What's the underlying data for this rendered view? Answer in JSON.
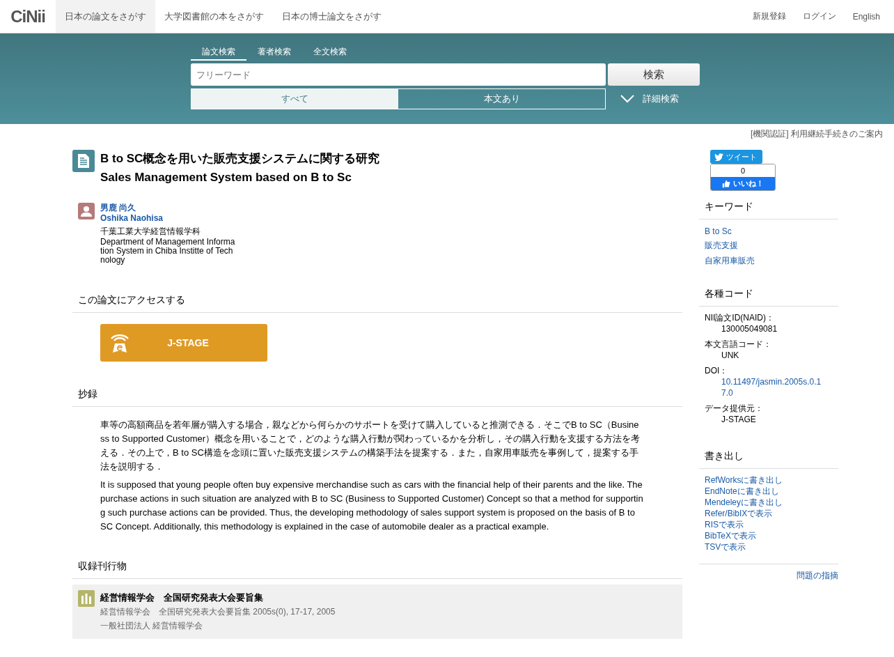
{
  "header": {
    "logo": "CiNii",
    "nav": [
      {
        "label": "日本の論文をさがす",
        "selected": true
      },
      {
        "label": "大学図書館の本をさがす",
        "selected": false
      },
      {
        "label": "日本の博士論文をさがす",
        "selected": false
      }
    ],
    "account_links": [
      "新規登録",
      "ログイン",
      "English"
    ]
  },
  "search": {
    "tabs": [
      {
        "label": "論文検索",
        "selected": true
      },
      {
        "label": "著者検索",
        "selected": false
      },
      {
        "label": "全文検索",
        "selected": false
      }
    ],
    "placeholder": "フリーワード",
    "button": "検索",
    "filters": [
      {
        "label": "すべて",
        "selected": true
      },
      {
        "label": "本文あり",
        "selected": false
      }
    ],
    "advanced": "詳細検索"
  },
  "notice": "[機関認証] 利用継続手続きのご案内",
  "article": {
    "title_ja": "B to SC概念を用いた販売支援システムに関する研究",
    "title_en": "Sales Management System based on B to Sc",
    "authors": [
      {
        "name_ja": "男鹿 尚久",
        "name_en": "Oshika Naohisa",
        "affiliation_ja": "千葉工業大学経営情報学科",
        "affiliation_en": "Department of Management Information System in Chiba Institte of Technology"
      }
    ],
    "access_heading": "この論文にアクセスする",
    "access_button": "J-STAGE",
    "abstract_heading": "抄録",
    "abstract": [
      "車等の高額商品を若年層が購入する場合，親などから何らかのサポートを受けて購入していると推測できる．そこでB to SC（Business to Supported Customer）概念を用いることで，どのような購入行動が関わっているかを分析し，その購入行動を支援する方法を考える．その上で，B to SC構造を念頭に置いた販売支援システムの構築手法を提案する．また，自家用車販売を事例して，提案する手法を説明する．",
      "It is supposed that young people often buy expensive merchandise such as cars with the financial help of their parents and the like. The purchase actions in such situation are analyzed with B to SC (Business to Supported Customer) Concept so that a method for supporting such purchase actions can be provided. Thus, the developing methodology of sales support system is proposed on the basis of B to SC Concept. Additionally, this methodology is explained in the case of automobile dealer as a practical example."
    ],
    "journal_heading": "収録刊行物",
    "journal": {
      "title": "経営情報学会　全国研究発表大会要旨集",
      "citation": "経営情報学会　全国研究発表大会要旨集 2005s(0), 17-17, 2005",
      "publisher": "一般社団法人 経営情報学会"
    }
  },
  "sidebar": {
    "tweet": "ツイート",
    "like_count": "0",
    "like": "いいね！",
    "keywords_heading": "キーワード",
    "keywords": [
      "B to Sc",
      "販売支援",
      "自家用車販売"
    ],
    "codes_heading": "各種コード",
    "codes": [
      {
        "label": "NII論文ID(NAID)：",
        "value": "130005049081",
        "kind": "text"
      },
      {
        "label": "本文言語コード：",
        "value": "UNK",
        "kind": "text"
      },
      {
        "label": "DOI：",
        "value": "10.11497/jasmin.2005s.0.17.0",
        "kind": "link"
      },
      {
        "label": "データ提供元：",
        "value": "J-STAGE",
        "kind": "text"
      }
    ],
    "export_heading": "書き出し",
    "exports": [
      "RefWorksに書き出し",
      "EndNoteに書き出し",
      "Mendeleyに書き出し",
      "Refer/BibIXで表示",
      "RISで表示",
      "BibTeXで表示",
      "TSVで表示"
    ],
    "report": "問題の指摘"
  }
}
